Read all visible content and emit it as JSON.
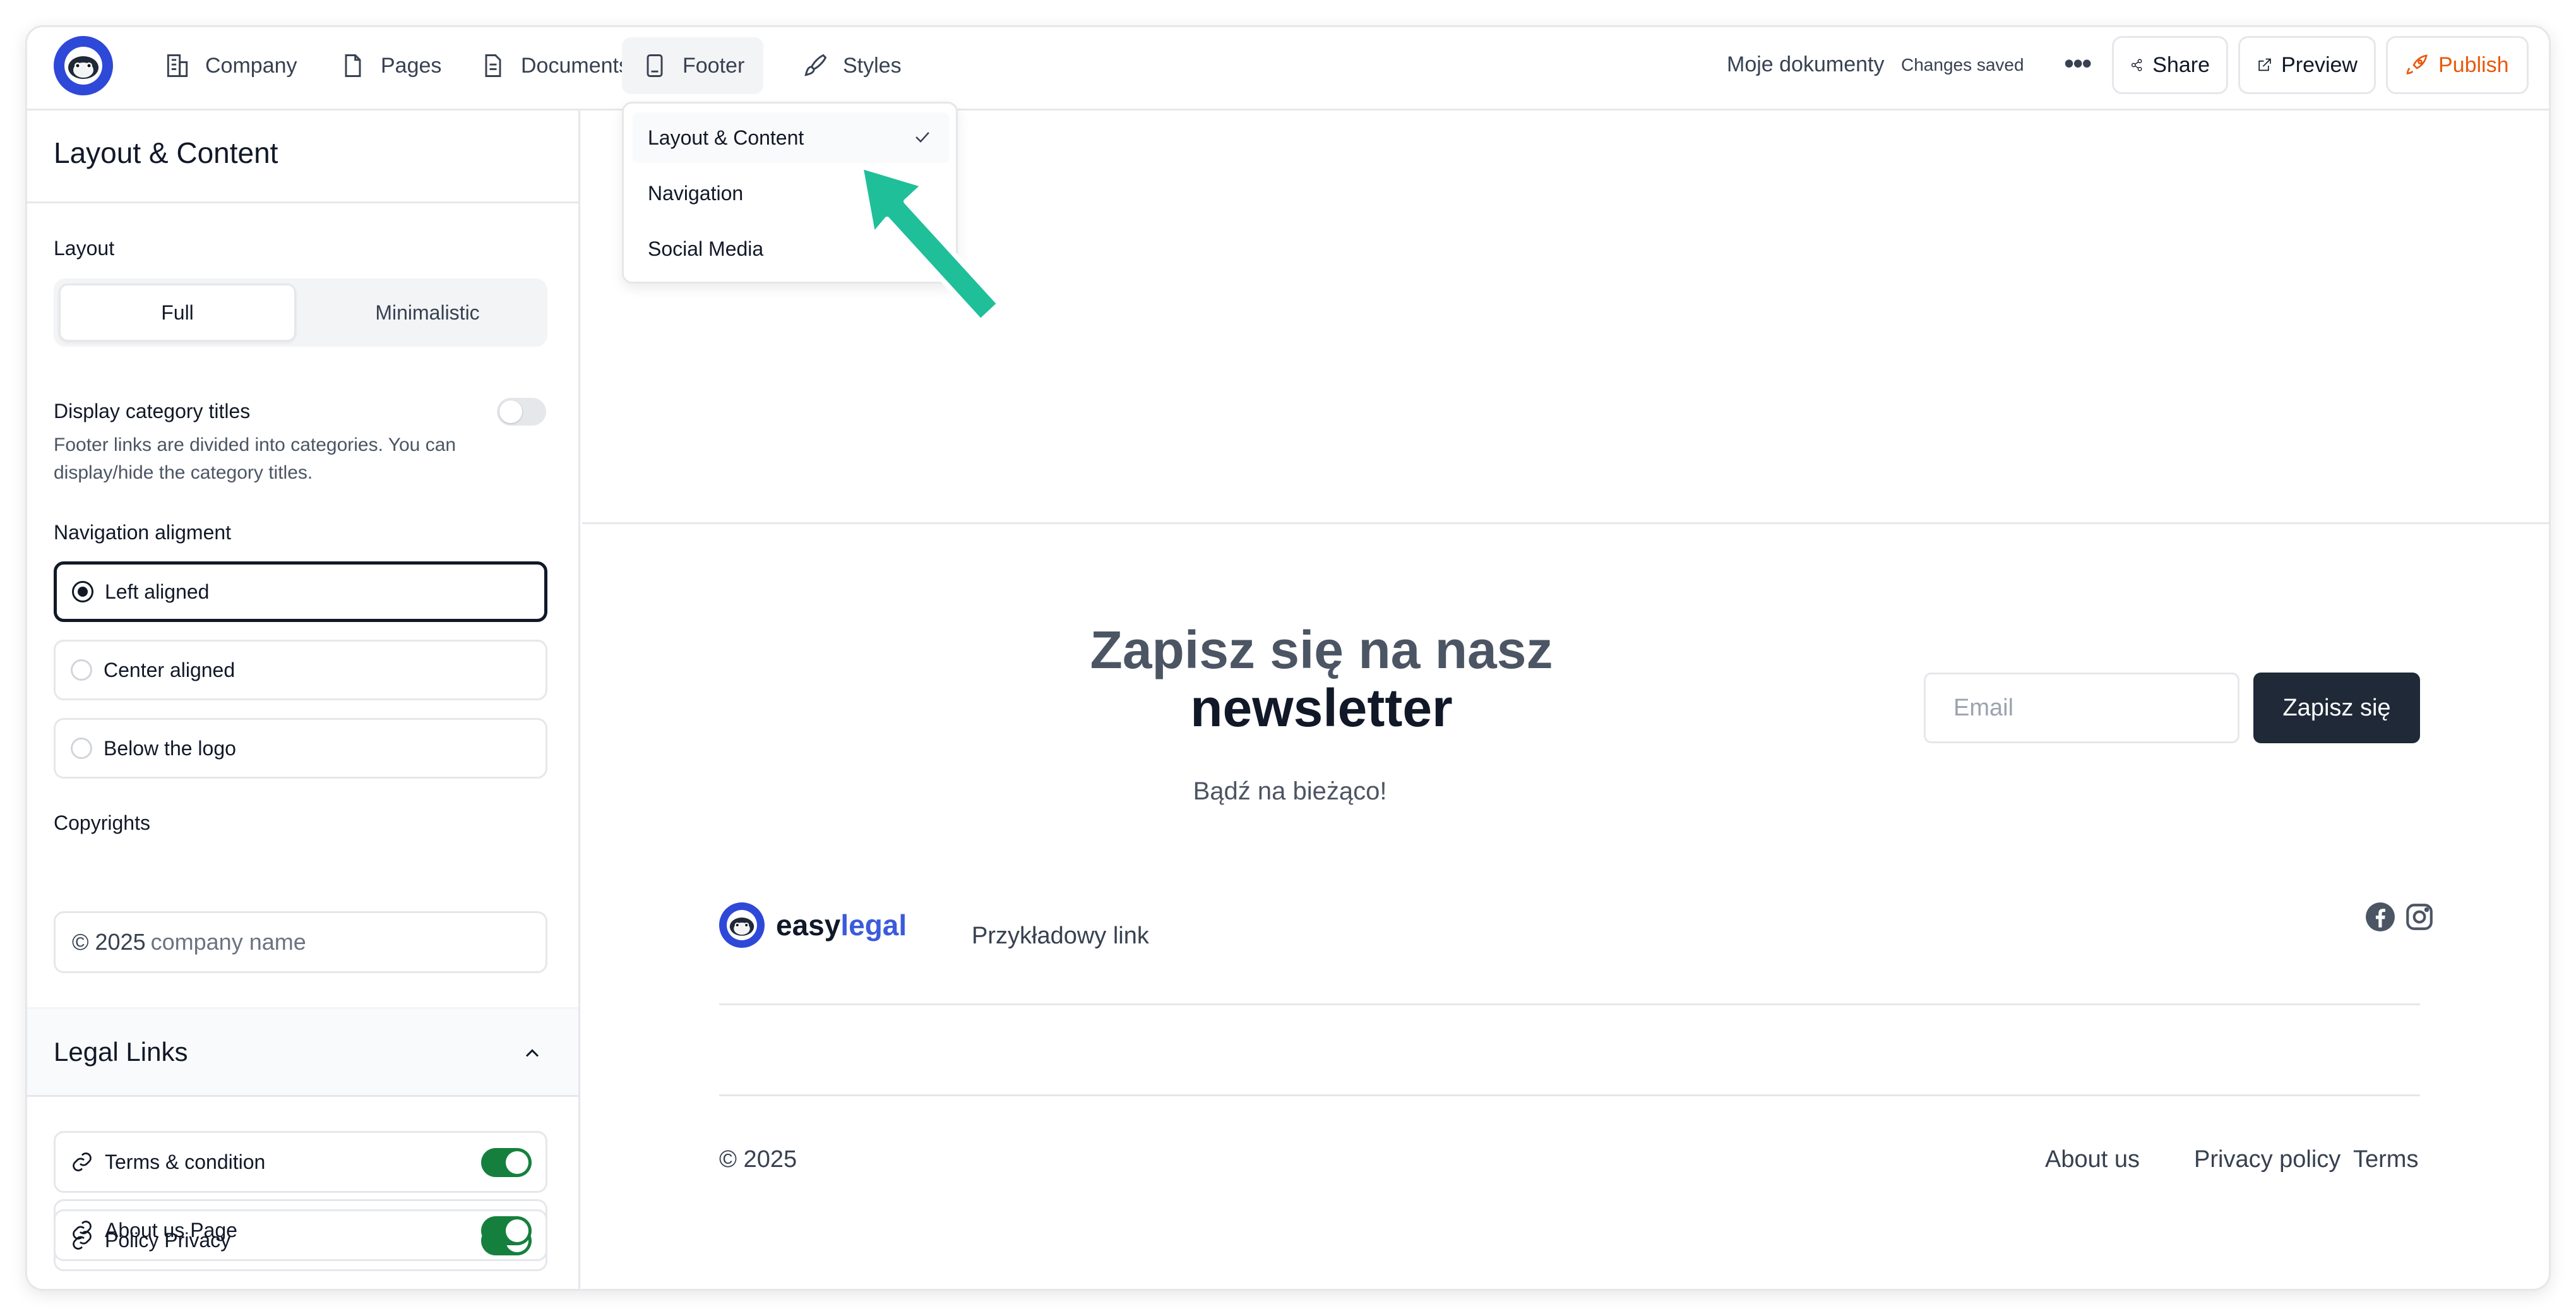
{
  "topbar": {
    "nav": [
      {
        "label": "Company",
        "icon": "building-icon"
      },
      {
        "label": "Pages",
        "icon": "page-icon"
      },
      {
        "label": "Documents",
        "icon": "document-icon"
      },
      {
        "label": "Footer",
        "icon": "footer-icon"
      },
      {
        "label": "Styles",
        "icon": "brush-icon"
      }
    ],
    "doc_name": "Moje dokumenty",
    "status": "Changes saved",
    "more": "•••",
    "share_label": "Share",
    "preview_label": "Preview",
    "publish_label": "Publish",
    "publish_color": "#e8590c"
  },
  "dropdown": {
    "items": [
      {
        "label": "Layout & Content",
        "checked": true
      },
      {
        "label": "Navigation",
        "checked": false
      },
      {
        "label": "Social Media",
        "checked": false
      }
    ]
  },
  "sidebar": {
    "title": "Layout & Content",
    "layout_label": "Layout",
    "layout_options": [
      "Full",
      "Minimalistic"
    ],
    "layout_selected": "Full",
    "category_label": "Display category titles",
    "category_enabled": false,
    "category_help": "Footer links are divided into categories. You can display/hide the category titles.",
    "nav_align_label": "Navigation aligment",
    "nav_align_options": [
      "Left aligned",
      "Center aligned",
      "Below the logo"
    ],
    "nav_align_selected": "Left aligned",
    "copyrights_label": "Copyrights",
    "copyright_prefix": "© 2025",
    "copyright_placeholder": "company name",
    "legal_title": "Legal Links",
    "legal_links": [
      {
        "label": "Terms & condition",
        "enabled": true
      },
      {
        "label": "Policy Privacy",
        "enabled": true
      },
      {
        "label": "About us Page",
        "enabled": true
      }
    ],
    "toggle_color": "#15803d"
  },
  "preview": {
    "newsletter_line1": "Zapisz się na nasz",
    "newsletter_line2": "newsletter",
    "newsletter_sub": "Bądź na bieżąco!",
    "email_placeholder": "Email",
    "subscribe_label": "Zapisz się",
    "brand_easy": "easy",
    "brand_legal": "legal",
    "sample_link": "Przykładowy link",
    "social": [
      "facebook-icon",
      "instagram-icon"
    ],
    "copyright": "© 2025",
    "footer_links": [
      "About us",
      "Privacy policy",
      "Terms"
    ]
  },
  "annotation": {
    "arrow_color": "#1fbf9a"
  }
}
